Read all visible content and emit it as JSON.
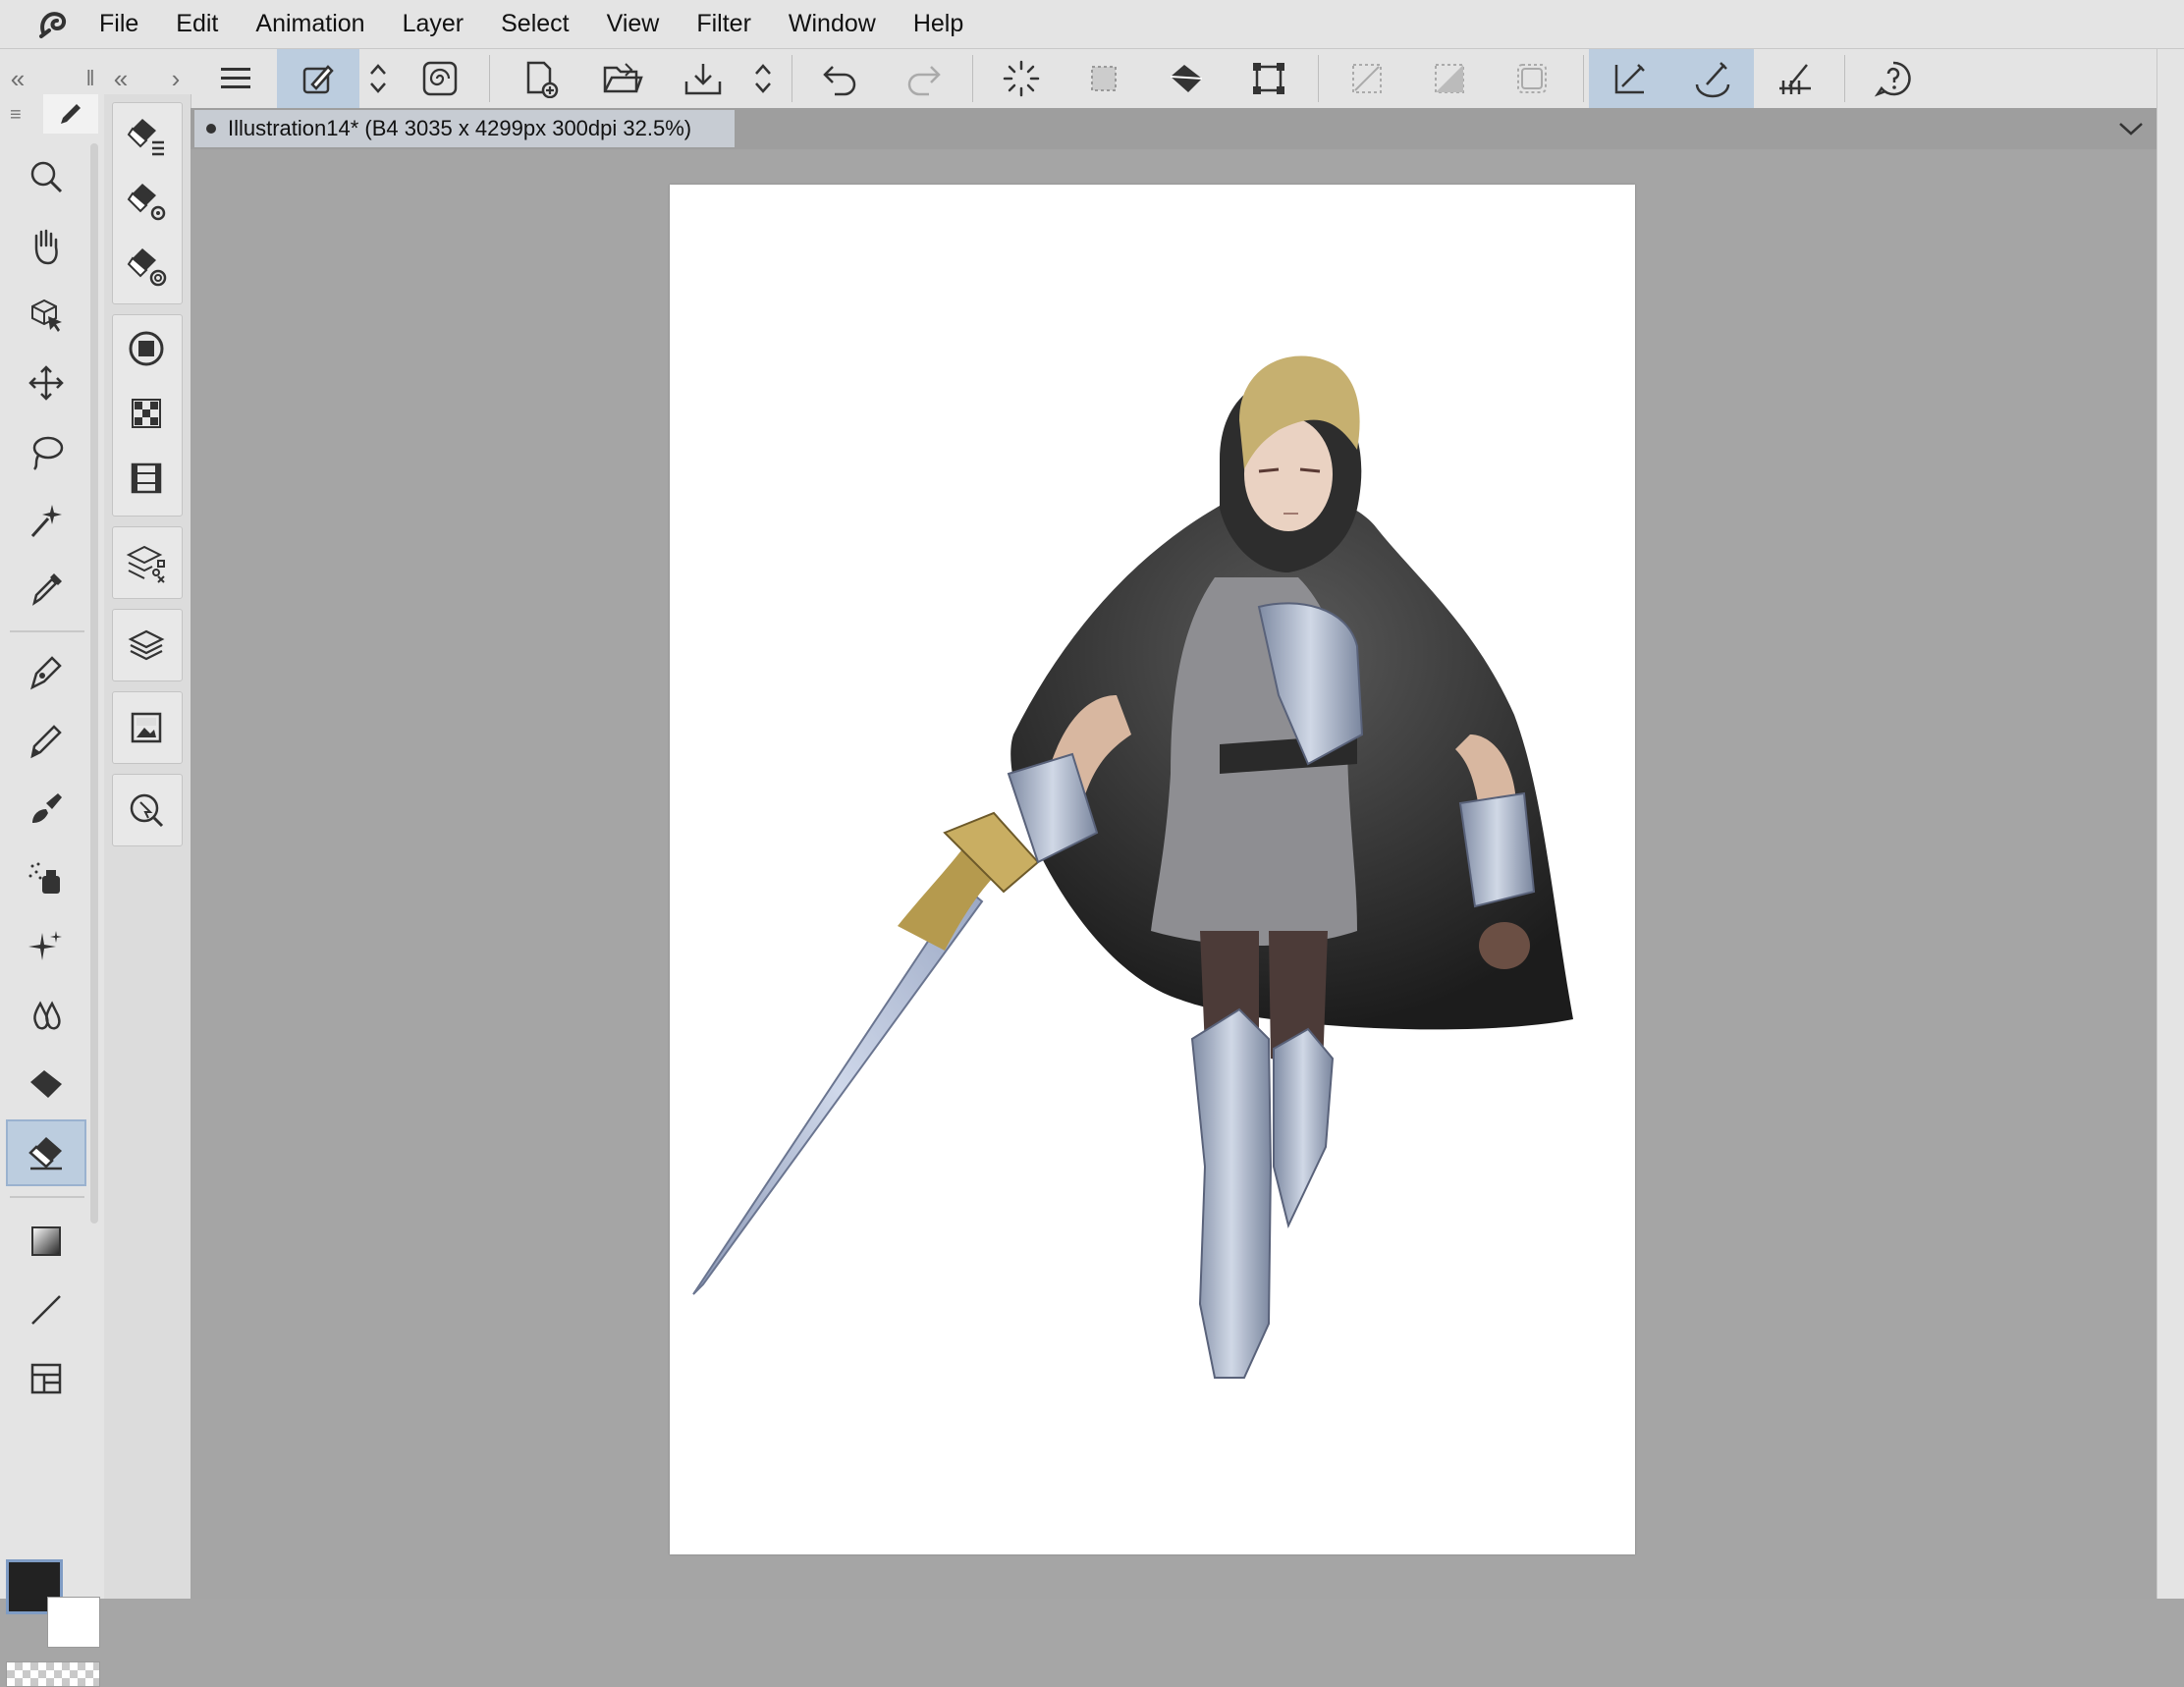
{
  "menu": {
    "items": [
      {
        "label": "File"
      },
      {
        "label": "Edit"
      },
      {
        "label": "Animation"
      },
      {
        "label": "Layer"
      },
      {
        "label": "Select"
      },
      {
        "label": "View"
      },
      {
        "label": "Filter"
      },
      {
        "label": "Window"
      },
      {
        "label": "Help"
      }
    ]
  },
  "document": {
    "tab_title": "Illustration14* (B4 3035 x 4299px 300dpi 32.5%)"
  },
  "colors": {
    "main": "#222222",
    "sub": "#ffffff",
    "accent": "#bccddf"
  },
  "toolbar_icons": [
    "hamburger-menu-icon",
    "brush-settings-icon",
    "spinner-icon",
    "spiral-icon",
    "new-canvas-icon",
    "open-folder-icon",
    "save-icon",
    "spinner-icon",
    "undo-icon",
    "redo-icon",
    "loading-ring-icon",
    "selection-icon",
    "fill-icon",
    "transform-icon",
    "clear-selection-icon",
    "invert-selection-icon",
    "show-selection-icon",
    "snap-to-ruler-icon",
    "snap-to-special-ruler-icon",
    "snap-to-grid-icon",
    "help-icon"
  ],
  "tools": [
    "zoom-icon",
    "hand-icon",
    "object-select-icon",
    "move-icon",
    "lasso-icon",
    "magic-wand-icon",
    "eyedropper-icon",
    "pen-icon",
    "pencil-icon",
    "brush-icon",
    "airbrush-icon",
    "decoration-icon",
    "blend-icon",
    "fill-bucket-icon",
    "eraser-icon",
    "gradient-icon",
    "line-icon",
    "frame-icon"
  ],
  "panels": [
    "sub-tool-icon",
    "tool-property-icon",
    "brush-size-icon",
    "color-wheel-icon",
    "color-set-icon",
    "timeline-icon",
    "layer-property-icon",
    "layer-icon",
    "navigator-icon",
    "search-layer-icon"
  ]
}
